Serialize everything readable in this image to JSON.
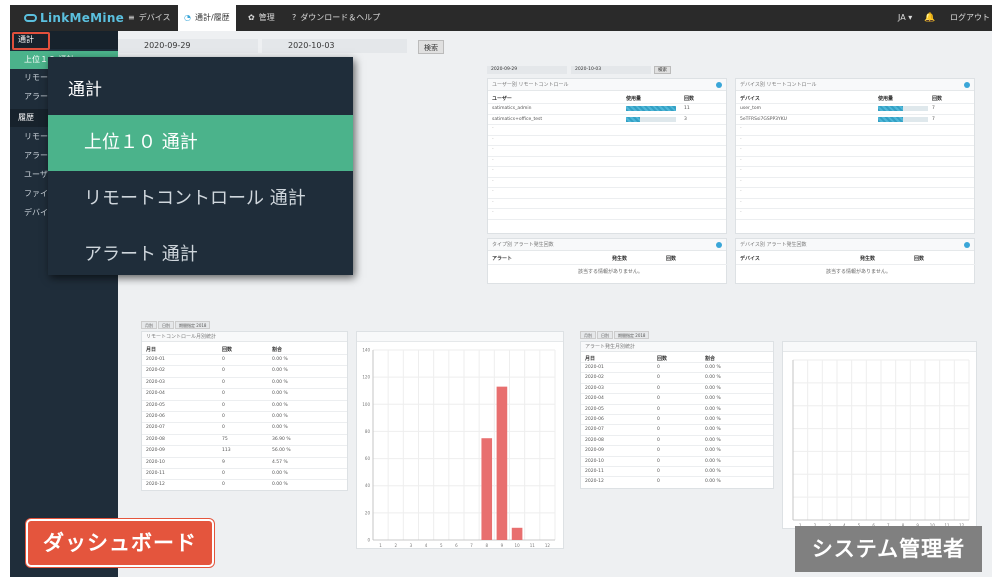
{
  "nav": {
    "logo": "LinkMeMine",
    "items": [
      {
        "icon": "≡",
        "label": "デバイス"
      },
      {
        "icon": "◔",
        "label": "通計/履歴"
      },
      {
        "icon": "✿",
        "label": "管理"
      },
      {
        "icon": "?",
        "label": "ダウンロード＆ヘルプ"
      }
    ],
    "lang": "JA ▾",
    "logout": "ログアウト"
  },
  "sidebar": {
    "items": [
      {
        "label": "通計",
        "kind": "head"
      },
      {
        "label": "上位１０ 通計",
        "kind": "active"
      },
      {
        "label": "リモートコントロール 通計",
        "kind": "sub"
      },
      {
        "label": "アラート 通計",
        "kind": "sub"
      },
      {
        "label": "履歴",
        "kind": "head"
      },
      {
        "label": "リモートコントロール",
        "kind": "sub"
      },
      {
        "label": "アラート",
        "kind": "sub"
      },
      {
        "label": "ユーザー",
        "kind": "sub"
      },
      {
        "label": "ファイル",
        "kind": "sub"
      },
      {
        "label": "デバイス",
        "kind": "sub"
      }
    ]
  },
  "filter": {
    "date_from": "2020-09-29",
    "date_to": "2020-10-03",
    "search": "検索"
  },
  "popup": {
    "title": "通計",
    "items": [
      {
        "label": "上位１０ 通計",
        "active": true
      },
      {
        "label": "リモートコントロール 通計",
        "active": false
      },
      {
        "label": "アラート 通計",
        "active": false
      }
    ]
  },
  "top10": {
    "date_from": "2020-09-29",
    "date_to": "2020-10-03",
    "search": "検索",
    "user_panel": {
      "title": "ユーザー別 リモートコントロール",
      "cols": [
        "ユーザー",
        "使用量",
        "回数"
      ],
      "rows": [
        {
          "name": "satimatics_admin",
          "count": "11",
          "ratio": 1.0
        },
        {
          "name": "satimatics+office_test",
          "count": "3",
          "ratio": 0.27
        }
      ]
    },
    "device_panel": {
      "title": "デバイス別 リモートコントロール",
      "cols": [
        "デバイス",
        "使用量",
        "回数"
      ],
      "rows": [
        {
          "name": "user_tom",
          "count": "7",
          "ratio": 0.5
        },
        {
          "name": "5eTFRSsi7GSPP3YKU",
          "count": "7",
          "ratio": 0.5
        }
      ]
    },
    "user_alert_panel": {
      "title": "タイプ別 アラート発生回数",
      "cols": [
        "アラート",
        "発生数",
        "回数"
      ],
      "empty": "該当する情報がありません。"
    },
    "device_alert_panel": {
      "title": "デバイス別 アラート発生回数",
      "cols": [
        "デバイス",
        "発生数",
        "回数"
      ],
      "empty": "該当する情報がありません。"
    }
  },
  "rc_stats": {
    "tabs": [
      "月別",
      "日別",
      "期間指定 2018"
    ],
    "title": "リモートコントロール月別統計",
    "cols": [
      "月日",
      "回数",
      "割合"
    ],
    "rows": [
      [
        "2020-01",
        "0",
        "0.00 %"
      ],
      [
        "2020-02",
        "0",
        "0.00 %"
      ],
      [
        "2020-03",
        "0",
        "0.00 %"
      ],
      [
        "2020-04",
        "0",
        "0.00 %"
      ],
      [
        "2020-05",
        "0",
        "0.00 %"
      ],
      [
        "2020-06",
        "0",
        "0.00 %"
      ],
      [
        "2020-07",
        "0",
        "0.00 %"
      ],
      [
        "2020-08",
        "75",
        "36.90 %"
      ],
      [
        "2020-09",
        "113",
        "56.00 %"
      ],
      [
        "2020-10",
        "9",
        "4.57 %"
      ],
      [
        "2020-11",
        "0",
        "0.00 %"
      ],
      [
        "2020-12",
        "0",
        "0.00 %"
      ]
    ]
  },
  "alert_stats": {
    "tabs": [
      "月別",
      "日別",
      "期間指定 2018"
    ],
    "title": "アラート発生月別統計",
    "cols": [
      "月日",
      "回数",
      "割合"
    ],
    "rows": [
      [
        "2020-01",
        "0",
        "0.00 %"
      ],
      [
        "2020-02",
        "0",
        "0.00 %"
      ],
      [
        "2020-03",
        "0",
        "0.00 %"
      ],
      [
        "2020-04",
        "0",
        "0.00 %"
      ],
      [
        "2020-05",
        "0",
        "0.00 %"
      ],
      [
        "2020-06",
        "0",
        "0.00 %"
      ],
      [
        "2020-07",
        "0",
        "0.00 %"
      ],
      [
        "2020-08",
        "0",
        "0.00 %"
      ],
      [
        "2020-09",
        "0",
        "0.00 %"
      ],
      [
        "2020-10",
        "0",
        "0.00 %"
      ],
      [
        "2020-11",
        "0",
        "0.00 %"
      ],
      [
        "2020-12",
        "0",
        "0.00 %"
      ]
    ]
  },
  "chart_data": [
    {
      "type": "bar",
      "title": "",
      "ylabel": "",
      "categories": [
        "1",
        "2",
        "3",
        "4",
        "5",
        "6",
        "7",
        "8",
        "9",
        "10",
        "11",
        "12"
      ],
      "values": [
        0,
        0,
        0,
        0,
        0,
        0,
        0,
        75,
        113,
        9,
        0,
        0
      ],
      "ylim": [
        0,
        140
      ],
      "yticks": [
        "0",
        "20",
        "40",
        "60",
        "80",
        "100",
        "120",
        "140"
      ],
      "color": "#e86f6f"
    },
    {
      "type": "bar",
      "title": "",
      "ylabel": "",
      "categories": [
        "1",
        "2",
        "3",
        "4",
        "5",
        "6",
        "7",
        "8",
        "9",
        "10",
        "11",
        "12"
      ],
      "values": [
        0,
        0,
        0,
        0,
        0,
        0,
        0,
        0,
        0,
        0,
        0,
        0
      ],
      "ylim": [
        0,
        1
      ],
      "color": "#e86f6f"
    }
  ],
  "labels": {
    "dashboard": "ダッシュボード",
    "admin": "システム管理者"
  }
}
